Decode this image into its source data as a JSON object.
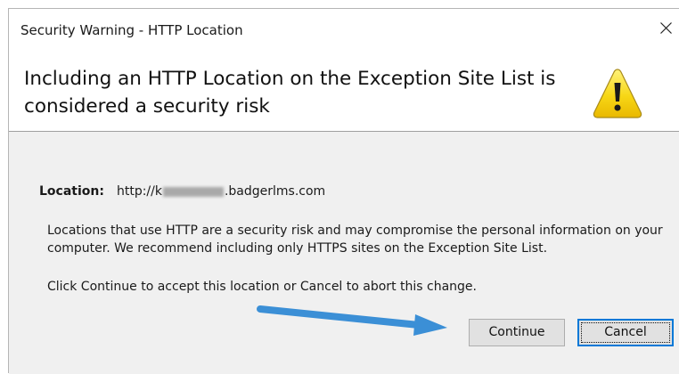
{
  "window": {
    "title": "Security Warning - HTTP Location"
  },
  "header": {
    "heading": "Including an HTTP Location on the Exception Site List is considered a security risk",
    "icon": "warning-icon"
  },
  "location": {
    "label": "Location:",
    "prefix": "http://k",
    "suffix": ".badgerlms.com"
  },
  "messages": {
    "description": "Locations that use HTTP are a security risk and may compromise the personal information on your computer.  We recommend including only HTTPS sites on the Exception Site List.",
    "instruction": "Click Continue to accept this location or Cancel to abort this change."
  },
  "buttons": {
    "continue_label": "Continue",
    "cancel_label": "Cancel"
  },
  "colors": {
    "warning_yellow": "#f7d716",
    "focus_blue": "#0078d7",
    "annotation_arrow": "#3b8fd6"
  }
}
